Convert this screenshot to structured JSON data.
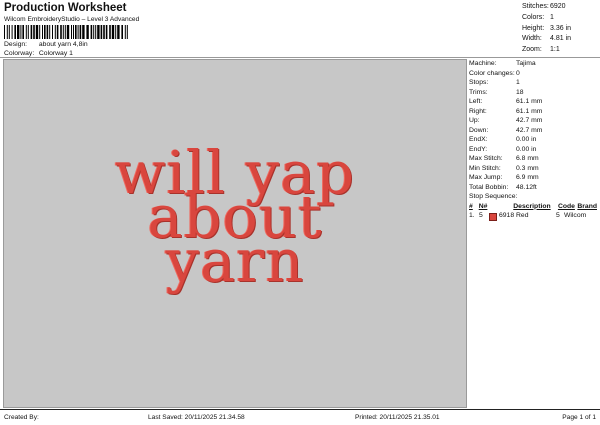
{
  "header": {
    "title": "Production Worksheet",
    "subtitle": "Wilcom EmbroideryStudio – Level 3 Advanced",
    "design_label": "Design:",
    "design_value": "about yarn 4,8in",
    "colorway_label": "Colorway:",
    "colorway_value": "Colorway 1"
  },
  "stats": [
    {
      "label": "Stitches:",
      "value": "6920"
    },
    {
      "label": "Colors:",
      "value": "1"
    },
    {
      "label": "Height:",
      "value": "3.36 in"
    },
    {
      "label": "Width:",
      "value": "4.81 in"
    },
    {
      "label": "Zoom:",
      "value": "1:1"
    }
  ],
  "design": {
    "lines": [
      "will yap",
      "about",
      "yarn"
    ],
    "thread_color": "#d9463e"
  },
  "machine_info": [
    {
      "label": "Machine:",
      "value": "Tajima"
    },
    {
      "label": "Color changes:",
      "value": "0"
    },
    {
      "label": "Stops:",
      "value": "1"
    },
    {
      "label": "Trims:",
      "value": "18"
    },
    {
      "label": "Left:",
      "value": "61.1 mm"
    },
    {
      "label": "Right:",
      "value": "61.1 mm"
    },
    {
      "label": "Up:",
      "value": "42.7 mm"
    },
    {
      "label": "Down:",
      "value": "42.7 mm"
    },
    {
      "label": "EndX:",
      "value": "0.00 in"
    },
    {
      "label": "EndY:",
      "value": "0.00 in"
    },
    {
      "label": "Max Stitch:",
      "value": "6.8 mm"
    },
    {
      "label": "Min Stitch:",
      "value": "0.3 mm"
    },
    {
      "label": "Max Jump:",
      "value": "6.9 mm"
    },
    {
      "label": "Total Bobbin:",
      "value": "48.12ft"
    }
  ],
  "stop_sequence": {
    "title": "Stop Sequence:",
    "headers": [
      "#",
      "N#",
      "Description",
      "Code",
      "Brand"
    ],
    "rows": [
      {
        "num": "1.",
        "needle": "5",
        "code_id": "6918",
        "description": "Red",
        "code": "5",
        "brand": "Wilcom",
        "color": "#d9463e"
      }
    ]
  },
  "footer": {
    "created_by": "Created By:",
    "last_saved": "Last Saved: 20/11/2025 21.34.58",
    "printed": "Printed: 20/11/2025 21.35.01",
    "page": "Page 1 of 1"
  }
}
